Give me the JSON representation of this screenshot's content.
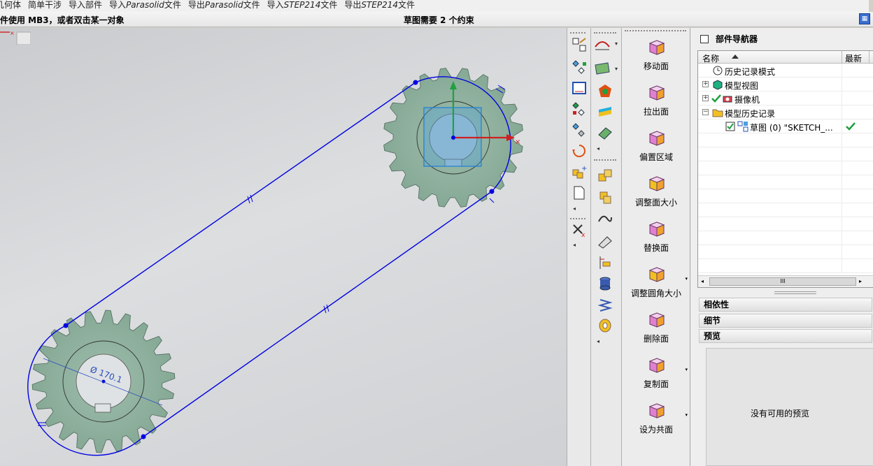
{
  "menubar": {
    "items": [
      {
        "text": "几何体"
      },
      {
        "text": "简单干涉"
      },
      {
        "text": "导入部件"
      },
      {
        "prefix": "导入 ",
        "italic": "Parasolid",
        "suffix": " 文件"
      },
      {
        "prefix": "导出 ",
        "italic": "Parasolid",
        "suffix": " 文件"
      },
      {
        "prefix": "导入 ",
        "italic": "STEP214",
        "suffix": " 文件"
      },
      {
        "prefix": "导出 ",
        "italic": "STEP214",
        "suffix": " 文件"
      }
    ]
  },
  "statusbar": {
    "hint": "件使用 MB3，或者双击某一对象",
    "status": "草图需要 2 个约束"
  },
  "sketch": {
    "dimension": "Ø 170.1"
  },
  "face_tools": [
    {
      "label": "移动面",
      "icon": "move-face-icon",
      "dropdown": false
    },
    {
      "label": "拉出面",
      "icon": "pull-face-icon",
      "dropdown": false
    },
    {
      "label": "偏置区域",
      "icon": "offset-region-icon",
      "dropdown": false
    },
    {
      "label": "调整面大小",
      "icon": "resize-face-icon",
      "dropdown": false
    },
    {
      "label": "替换面",
      "icon": "replace-face-icon",
      "dropdown": false
    },
    {
      "label": "调整圆角大小",
      "icon": "resize-blend-icon",
      "dropdown": true
    },
    {
      "label": "删除面",
      "icon": "delete-face-icon",
      "dropdown": false
    },
    {
      "label": "复制面",
      "icon": "copy-face-icon",
      "dropdown": true
    },
    {
      "label": "设为共面",
      "icon": "make-coplanar-icon",
      "dropdown": true
    }
  ],
  "navigator": {
    "title": "部件导航器",
    "col_name": "名称",
    "col_latest": "最新",
    "rows": [
      {
        "label": "历史记录模式",
        "icon": "clock-icon",
        "indent": 20,
        "expander": ""
      },
      {
        "label": "模型视图",
        "icon": "model-views-icon",
        "indent": 20,
        "expander": "+"
      },
      {
        "label": "摄像机",
        "icon": "camera-icon",
        "indent": 34,
        "expander": "+"
      },
      {
        "label": "模型历史记录",
        "icon": "folder-icon",
        "indent": 20,
        "expander": "−"
      },
      {
        "label": "草图 (0) \"SKETCH_...",
        "icon": "sketch-icon",
        "indent": 56,
        "expander": ""
      }
    ],
    "scroll_thumb": "III"
  },
  "sections": {
    "dependency": "相依性",
    "details": "细节",
    "preview": "预览",
    "preview_empty": "没有可用的预览"
  },
  "colors": {
    "gear_fill": "#8fb29f",
    "chain": "#0000e0",
    "x_axis": "#d02020",
    "y_axis": "#20a040"
  }
}
